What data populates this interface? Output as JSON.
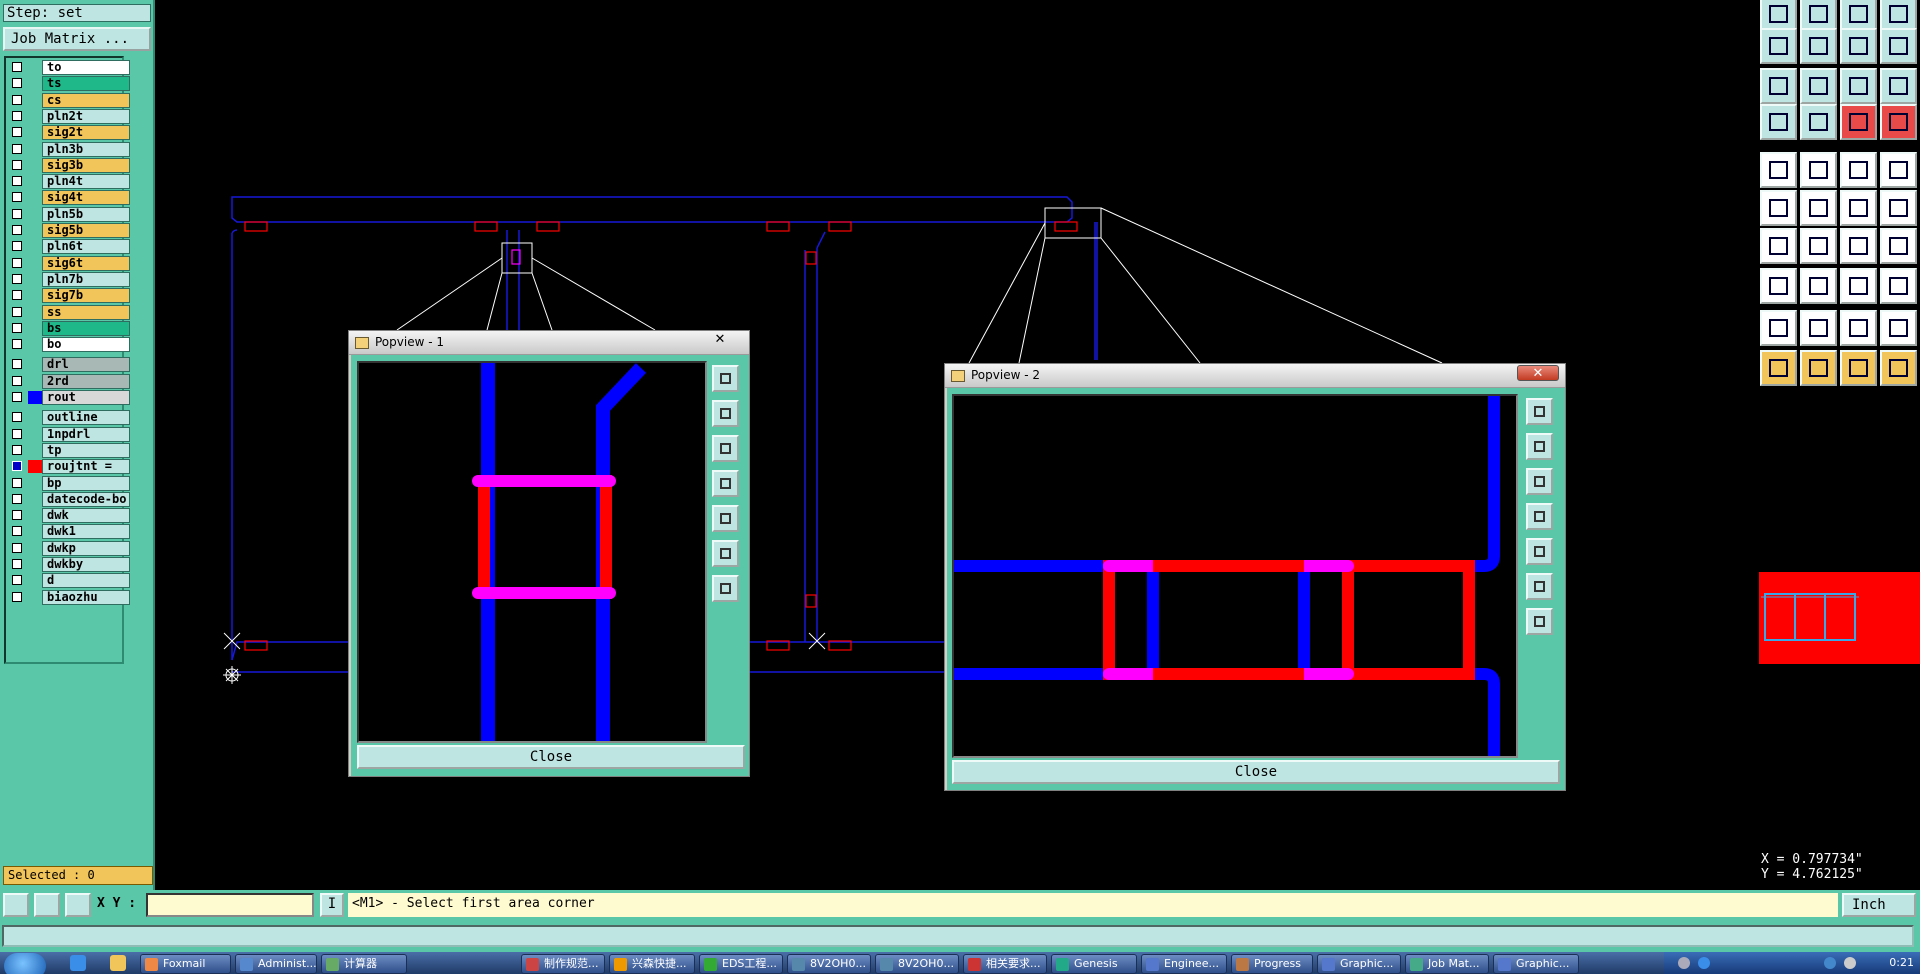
{
  "left_panel": {
    "step_text": "Step: set",
    "job_matrix_label": "Job Matrix ...",
    "layers": [
      {
        "name": "to",
        "bg": "#ffffff",
        "color": "",
        "checked": false
      },
      {
        "name": "ts",
        "bg": "#1fb888",
        "color": "",
        "checked": false
      },
      {
        "name": "cs",
        "bg": "#f2c55a",
        "color": "",
        "checked": false
      },
      {
        "name": "pln2t",
        "bg": "#bfe5e2",
        "color": "",
        "checked": false
      },
      {
        "name": "sig2t",
        "bg": "#f2c55a",
        "color": "",
        "checked": false
      },
      {
        "name": "pln3b",
        "bg": "#bfe5e2",
        "color": "",
        "checked": false
      },
      {
        "name": "sig3b",
        "bg": "#f2c55a",
        "color": "",
        "checked": false
      },
      {
        "name": "pln4t",
        "bg": "#bfe5e2",
        "color": "",
        "checked": false
      },
      {
        "name": "sig4t",
        "bg": "#f2c55a",
        "color": "",
        "checked": false
      },
      {
        "name": "pln5b",
        "bg": "#bfe5e2",
        "color": "",
        "checked": false
      },
      {
        "name": "sig5b",
        "bg": "#f2c55a",
        "color": "",
        "checked": false
      },
      {
        "name": "pln6t",
        "bg": "#bfe5e2",
        "color": "",
        "checked": false
      },
      {
        "name": "sig6t",
        "bg": "#f2c55a",
        "color": "",
        "checked": false
      },
      {
        "name": "pln7b",
        "bg": "#bfe5e2",
        "color": "",
        "checked": false
      },
      {
        "name": "sig7b",
        "bg": "#f2c55a",
        "color": "",
        "checked": false
      },
      {
        "name": "ss",
        "bg": "#f2c55a",
        "color": "",
        "checked": false
      },
      {
        "name": "bs",
        "bg": "#1fb888",
        "color": "",
        "checked": false
      },
      {
        "name": "bo",
        "bg": "#ffffff",
        "color": "",
        "checked": false
      },
      {
        "name": "drl",
        "bg": "#a8b8b4",
        "color": "",
        "checked": false
      },
      {
        "name": "2rd",
        "bg": "#a8b8b4",
        "color": "",
        "checked": false
      },
      {
        "name": "rout",
        "bg": "#d8d8d8",
        "color": "#0000ff",
        "checked": false
      },
      {
        "name": "outline",
        "bg": "#bfe5e2",
        "color": "",
        "checked": false
      },
      {
        "name": "1npdrl",
        "bg": "#bfe5e2",
        "color": "",
        "checked": false
      },
      {
        "name": "tp",
        "bg": "#bfe5e2",
        "color": "",
        "checked": false
      },
      {
        "name": "roujtnt   =",
        "bg": "#bfe5e2",
        "color": "#ff0000",
        "checked": true
      },
      {
        "name": "bp",
        "bg": "#bfe5e2",
        "color": "",
        "checked": false
      },
      {
        "name": "datecode-bo",
        "bg": "#bfe5e2",
        "color": "",
        "checked": false
      },
      {
        "name": "dwk",
        "bg": "#bfe5e2",
        "color": "",
        "checked": false
      },
      {
        "name": "dwk1",
        "bg": "#bfe5e2",
        "color": "",
        "checked": false
      },
      {
        "name": "dwkp",
        "bg": "#bfe5e2",
        "color": "",
        "checked": false
      },
      {
        "name": "dwkby",
        "bg": "#bfe5e2",
        "color": "",
        "checked": false
      },
      {
        "name": "d",
        "bg": "#bfe5e2",
        "color": "",
        "checked": false
      },
      {
        "name": "biaozhu",
        "bg": "#bfe5e2",
        "color": "",
        "checked": false
      }
    ],
    "selected_text": "Selected : 0"
  },
  "popview1": {
    "title": "Popview - 1",
    "close_x": "✕",
    "close_label": "Close"
  },
  "popview2": {
    "title": "Popview - 2",
    "close_x": "✕",
    "close_label": "Close"
  },
  "coords": {
    "x_text": "X = 0.797734\"",
    "y_text": "Y = 4.762125\""
  },
  "command_bar": {
    "xy_label": "X Y :",
    "xy_value": "",
    "mark": "I",
    "message": "<M1> - Select first area corner",
    "unit": "Inch"
  },
  "taskbar": {
    "items": [
      "Foxmail",
      "Administ...",
      "计算器",
      "制作规范...",
      "兴森快捷...",
      "EDS工程...",
      "8V2OH0...",
      "8V2OH0...",
      "相关要求...",
      "Genesis",
      "Enginee...",
      "Progress",
      "Graphic...",
      "Job Mat...",
      "Graphic..."
    ],
    "clock": "0:21"
  },
  "colors": {
    "panel": "#5ac8a8",
    "button": "#bfe5e2",
    "signal": "#f2c55a",
    "trace_blue": "#0000ff",
    "pad_red": "#ff0000",
    "magenta": "#ff00ff"
  }
}
